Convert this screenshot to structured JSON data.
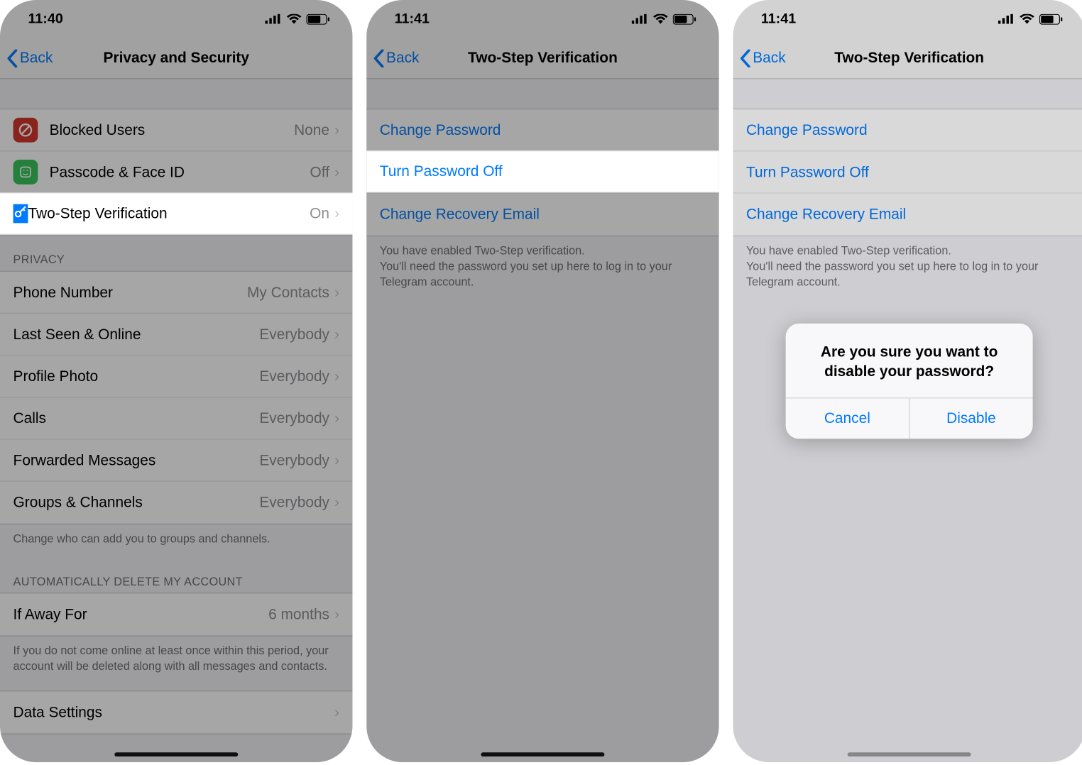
{
  "screen1": {
    "time": "11:40",
    "back": "Back",
    "title": "Privacy and Security",
    "security": [
      {
        "icon": "block",
        "label": "Blocked Users",
        "value": "None"
      },
      {
        "icon": "passcode",
        "label": "Passcode & Face ID",
        "value": "Off"
      },
      {
        "icon": "key",
        "label": "Two-Step Verification",
        "value": "On"
      }
    ],
    "privacy_header": "Privacy",
    "privacy": [
      {
        "label": "Phone Number",
        "value": "My Contacts"
      },
      {
        "label": "Last Seen & Online",
        "value": "Everybody"
      },
      {
        "label": "Profile Photo",
        "value": "Everybody"
      },
      {
        "label": "Calls",
        "value": "Everybody"
      },
      {
        "label": "Forwarded Messages",
        "value": "Everybody"
      },
      {
        "label": "Groups & Channels",
        "value": "Everybody"
      }
    ],
    "privacy_footer": "Change who can add you to groups and channels.",
    "auto_header": "Automatically Delete My Account",
    "auto_row": {
      "label": "If Away For",
      "value": "6 months"
    },
    "auto_footer": "If you do not come online at least once within this period, your account will be deleted along with all messages and contacts.",
    "data_settings": "Data Settings"
  },
  "screen2": {
    "time": "11:41",
    "back": "Back",
    "title": "Two-Step Verification",
    "rows": [
      "Change Password",
      "Turn Password Off",
      "Change Recovery Email"
    ],
    "footer": "You have enabled Two-Step verification.\nYou'll need the password you set up here to log in to your Telegram account."
  },
  "screen3": {
    "time": "11:41",
    "back": "Back",
    "title": "Two-Step Verification",
    "rows": [
      "Change Password",
      "Turn Password Off",
      "Change Recovery Email"
    ],
    "footer": "You have enabled Two-Step verification.\nYou'll need the password you set up here to log in to your Telegram account.",
    "alert": {
      "title": "Are you sure you want to disable your password?",
      "cancel": "Cancel",
      "confirm": "Disable"
    }
  }
}
